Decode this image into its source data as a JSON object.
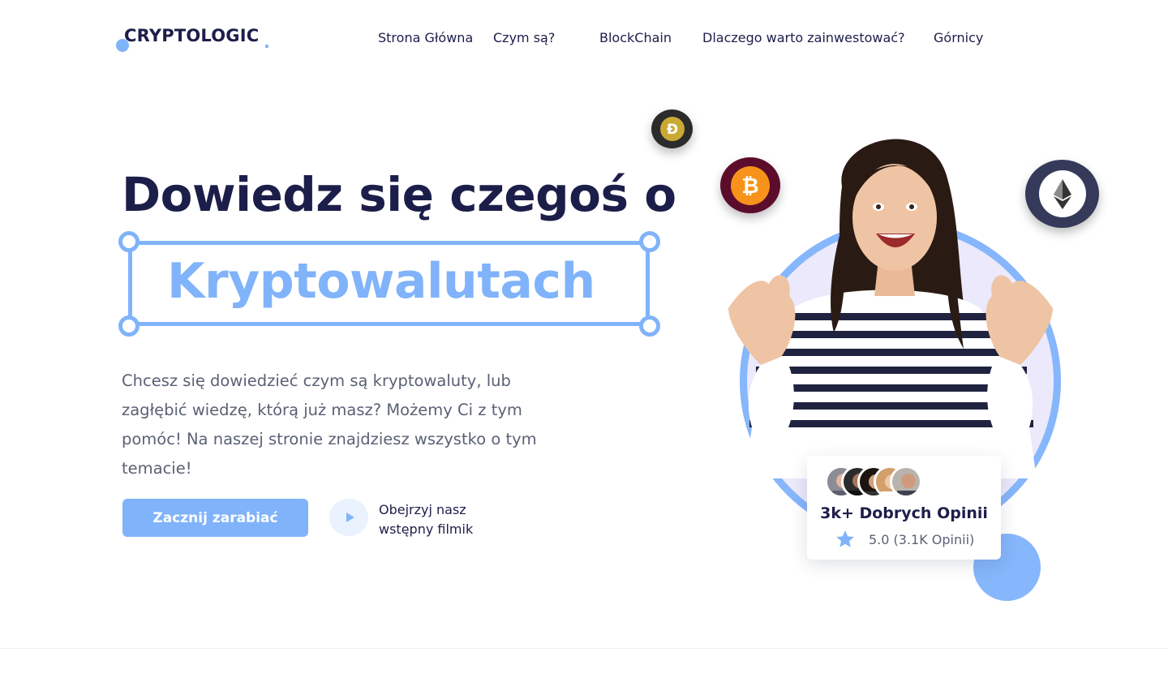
{
  "header": {
    "logo_text": "CRYPTOLOGIC",
    "logo_period": ".",
    "nav": [
      {
        "label": "Strona  Główna"
      },
      {
        "label": "Czym są?"
      },
      {
        "label": "BlockChain"
      },
      {
        "label": "Dlaczego warto zainwestować?"
      },
      {
        "label": "Górnicy"
      }
    ]
  },
  "hero": {
    "title": "Dowiedz się czegoś o",
    "highlight": "Kryptowalutach",
    "description": "Chcesz się dowiedzieć czym są kryptowaluty, lub zagłębić wiedzę, którą już masz? Możemy Ci z tym pomóc! Na naszej stronie znajdziesz wszystko o tym temacie!",
    "cta_label": "Zacznij zarabiać",
    "video_line1": "Obejrzyj nasz",
    "video_line2": "wstępny filmik"
  },
  "visual": {
    "coins": [
      "dogecoin-icon",
      "bitcoin-icon",
      "ethereum-icon"
    ],
    "review": {
      "title": "3k+ Dobrych Opinii",
      "rating": "5.0 (3.1K Opinii)"
    }
  },
  "colors": {
    "accent": "#80b3fa",
    "dark": "#1c1e4a",
    "muted": "#5a6175",
    "ring_fill": "#ebe9fb"
  }
}
